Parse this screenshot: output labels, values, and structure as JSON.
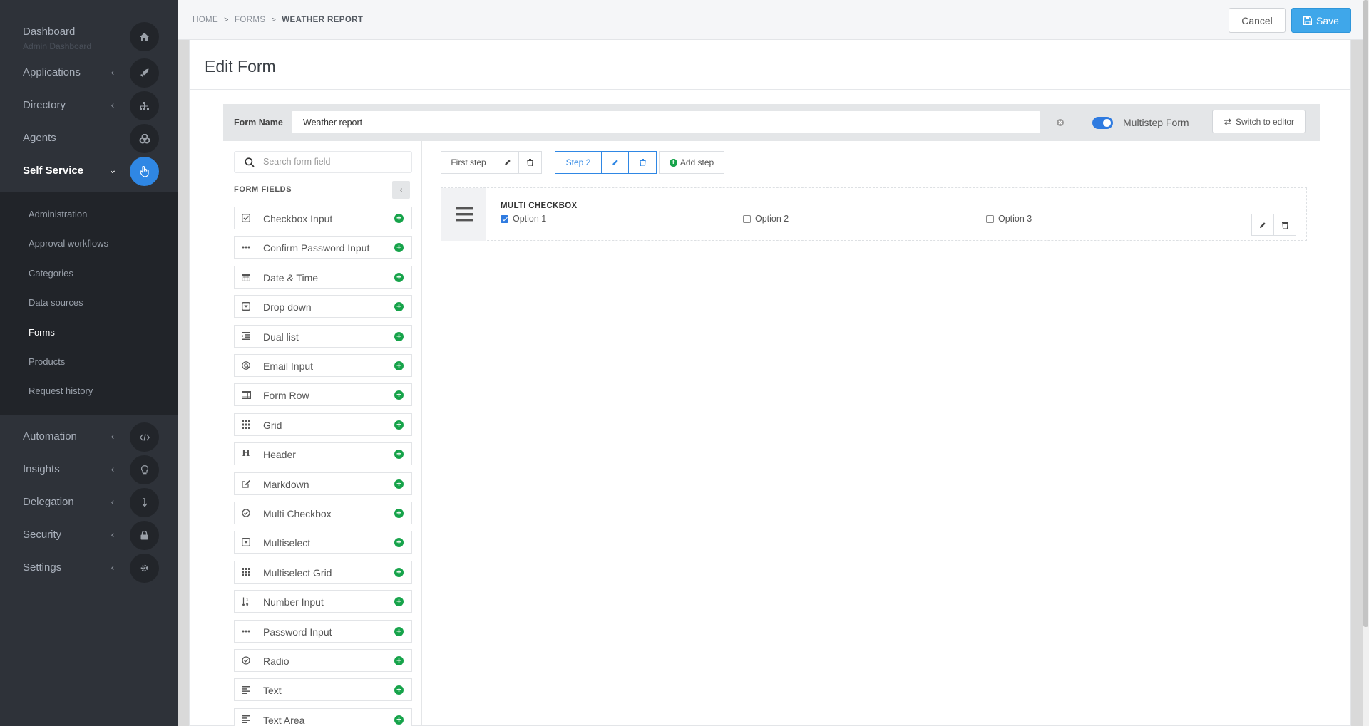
{
  "sidebar": {
    "items": [
      {
        "label": "Dashboard",
        "sublabel": "Admin Dashboard",
        "icon": "home-icon"
      },
      {
        "label": "Applications",
        "icon": "rocket-icon"
      },
      {
        "label": "Directory",
        "icon": "sitemap-icon"
      },
      {
        "label": "Agents",
        "icon": "cogs-icon"
      },
      {
        "label": "Self Service",
        "icon": "pointer-hand-icon",
        "active": true
      },
      {
        "label": "Automation",
        "icon": "code-icon"
      },
      {
        "label": "Insights",
        "icon": "lightbulb-icon"
      },
      {
        "label": "Delegation",
        "icon": "arrow-down-icon"
      },
      {
        "label": "Security",
        "icon": "lock-icon"
      },
      {
        "label": "Settings",
        "icon": "gear-icon"
      }
    ],
    "subitems": [
      "Administration",
      "Approval workflows",
      "Categories",
      "Data sources",
      "Forms",
      "Products",
      "Request history"
    ],
    "active_subitem": "Forms"
  },
  "breadcrumb": {
    "home": "HOME",
    "forms": "FORMS",
    "current": "WEATHER REPORT"
  },
  "header": {
    "cancel_label": "Cancel",
    "save_label": "Save",
    "accent": "#3fa7ea"
  },
  "page": {
    "title": "Edit Form"
  },
  "form": {
    "name_label": "Form Name",
    "name_value": "Weather report",
    "multistep_label": "Multistep Form",
    "multistep_enabled": true,
    "switch_label": "Switch to editor"
  },
  "fields_panel": {
    "search_placeholder": "Search form field",
    "title": "FORM FIELDS",
    "items": [
      {
        "label": "Checkbox Input",
        "icon": "checkbox-icon"
      },
      {
        "label": "Confirm Password Input",
        "icon": "ellipsis-icon"
      },
      {
        "label": "Date & Time",
        "icon": "calendar-icon"
      },
      {
        "label": "Drop down",
        "icon": "dropdown-icon"
      },
      {
        "label": "Dual list",
        "icon": "indent-icon"
      },
      {
        "label": "Email Input",
        "icon": "at-icon"
      },
      {
        "label": "Form Row",
        "icon": "table-icon"
      },
      {
        "label": "Grid",
        "icon": "grid-icon"
      },
      {
        "label": "Header",
        "icon": "heading-icon"
      },
      {
        "label": "Markdown",
        "icon": "edit-icon"
      },
      {
        "label": "Multi Checkbox",
        "icon": "check-circle-icon"
      },
      {
        "label": "Multiselect",
        "icon": "dropdown-icon"
      },
      {
        "label": "Multiselect Grid",
        "icon": "grid-icon"
      },
      {
        "label": "Number Input",
        "icon": "number-sort-icon"
      },
      {
        "label": "Password Input",
        "icon": "ellipsis-icon"
      },
      {
        "label": "Radio",
        "icon": "check-circle-icon"
      },
      {
        "label": "Text",
        "icon": "align-left-icon"
      },
      {
        "label": "Text Area",
        "icon": "align-left-icon"
      }
    ]
  },
  "steps": {
    "first_label": "First step",
    "second_label": "Step 2",
    "add_label": "Add step"
  },
  "multi_checkbox": {
    "title": "MULTI CHECKBOX",
    "options": [
      {
        "label": "Option 1",
        "checked": true
      },
      {
        "label": "Option 2",
        "checked": false
      },
      {
        "label": "Option 3",
        "checked": false
      }
    ]
  }
}
